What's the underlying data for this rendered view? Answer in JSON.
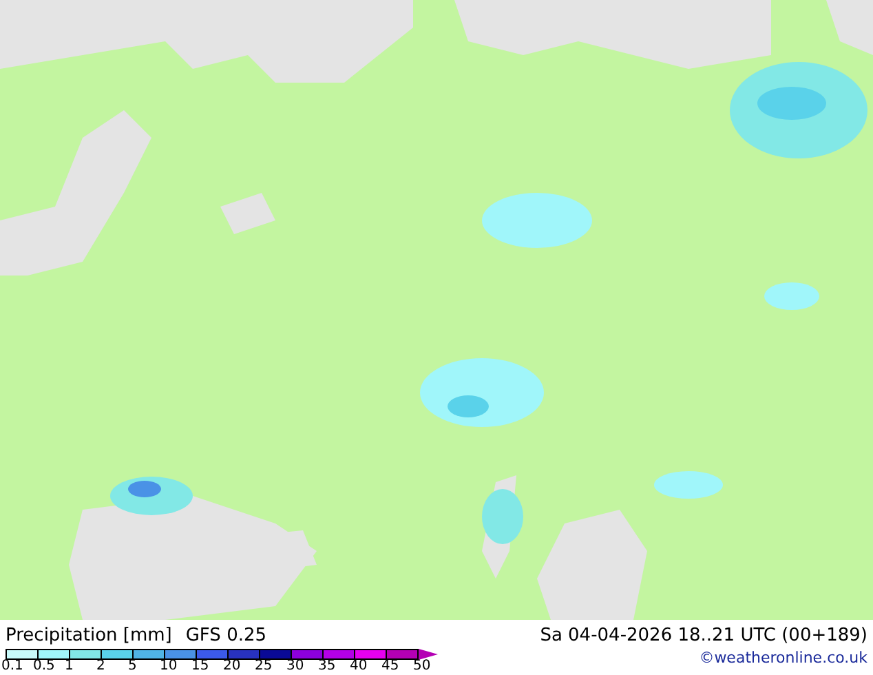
{
  "legend": {
    "title": "Precipitation [mm]",
    "model": "GFS 0.25",
    "swatches": [
      {
        "color": "#c8fafa"
      },
      {
        "color": "#a0f6fa"
      },
      {
        "color": "#82e8e6"
      },
      {
        "color": "#5ad2ea"
      },
      {
        "color": "#50b4e6"
      },
      {
        "color": "#4a92e6"
      },
      {
        "color": "#3c5aea"
      },
      {
        "color": "#2832c0"
      },
      {
        "color": "#0a0a96"
      },
      {
        "color": "#8c00dc"
      },
      {
        "color": "#b400e6"
      },
      {
        "color": "#e600f0"
      },
      {
        "color": "#b400b4"
      }
    ],
    "labels": [
      "0.1",
      "0.5",
      "1",
      "2",
      "5",
      "10",
      "15",
      "20",
      "25",
      "30",
      "35",
      "40",
      "45",
      "50"
    ]
  },
  "valid_time": "Sa 04-04-2026 18..21 UTC (00+189)",
  "credit": "©weatheronline.co.uk"
}
